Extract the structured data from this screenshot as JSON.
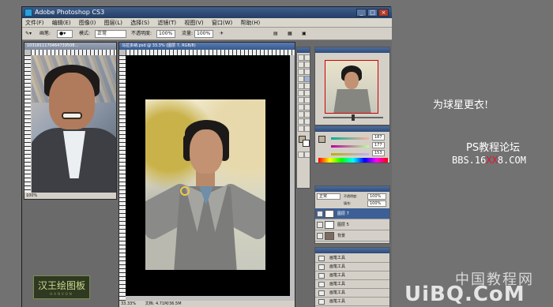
{
  "app": {
    "title": "Adobe Photoshop CS3"
  },
  "menu": [
    "文件(F)",
    "编辑(E)",
    "图像(I)",
    "图层(L)",
    "选择(S)",
    "滤镜(T)",
    "视图(V)",
    "窗口(W)",
    "帮助(H)"
  ],
  "options": {
    "brush_label": "画笔:",
    "mode_label": "模式:",
    "mode_value": "正常",
    "opacity_label": "不透明度:",
    "opacity_value": "100%",
    "flow_label": "流量:",
    "flow_value": "100%"
  },
  "documents": {
    "left_title": "1031811170464739508...",
    "left_zoom": "100%",
    "main_title": "马拉多纳.psd @ 33.3% (图层 7, RGB/8)",
    "main_zoom": "33.33%",
    "main_status": "文档: 4.71M/36.5M"
  },
  "layers": {
    "blend_mode": "正常",
    "opacity_label": "不透明度:",
    "opacity_value": "100%",
    "fill_label": "填充:",
    "fill_value": "100%",
    "items": [
      {
        "name": "图层 7"
      },
      {
        "name": "图层 5"
      },
      {
        "name": "背景"
      }
    ]
  },
  "color": {
    "r": "187",
    "g": "177",
    "b": "153"
  },
  "history": {
    "items": [
      "画笔工具",
      "画笔工具",
      "画笔工具",
      "画笔工具",
      "画笔工具",
      "画笔工具",
      "画笔工具"
    ]
  },
  "overlays": {
    "caption": "为球星更衣!",
    "forum_name": "PS教程论坛",
    "forum_url_prefix": "BBS.16",
    "forum_url_xx": "XX",
    "forum_url_suffix": "8.COM",
    "logo_main": "汉王绘图板",
    "logo_sub": "HANVON",
    "watermark_cn": "中国教程网",
    "watermark_en": "UiBQ.CoM"
  },
  "colors": {
    "accent_red": "#e3142b",
    "panel_gray": "#d4d0c8"
  }
}
